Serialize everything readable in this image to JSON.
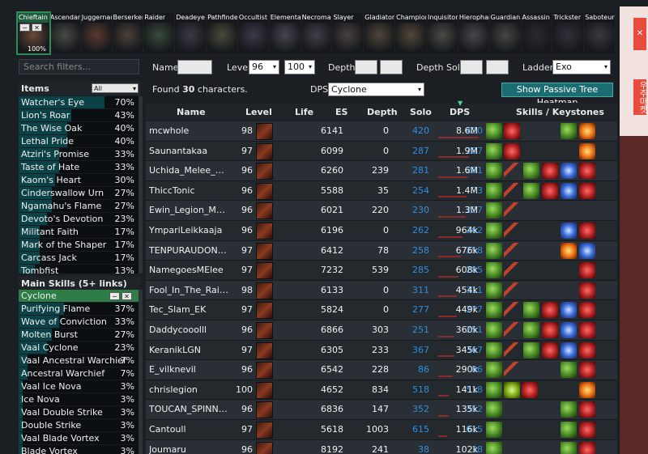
{
  "class_bar": {
    "active_percent": "100%",
    "classes": [
      {
        "name": "Chieftain",
        "active": true,
        "color": "#6a4a3a"
      },
      {
        "name": "Ascendant",
        "color": "#4a4a44"
      },
      {
        "name": "Juggernaut",
        "color": "#5a3a30"
      },
      {
        "name": "Berserker",
        "color": "#4a4038"
      },
      {
        "name": "Raider",
        "color": "#3a4a3a"
      },
      {
        "name": "Deadeye",
        "color": "#3a3a44"
      },
      {
        "name": "Pathfinder",
        "color": "#4a4a3a"
      },
      {
        "name": "Occultist",
        "color": "#3a3a4a"
      },
      {
        "name": "Elementalist",
        "color": "#4a4450"
      },
      {
        "name": "Necromancer",
        "color": "#404048"
      },
      {
        "name": "Slayer",
        "color": "#4a4040"
      },
      {
        "name": "Gladiator",
        "color": "#50463a"
      },
      {
        "name": "Champion",
        "color": "#54483a"
      },
      {
        "name": "Inquisitor",
        "color": "#4c4a44"
      },
      {
        "name": "Hierophant",
        "color": "#48484a"
      },
      {
        "name": "Guardian",
        "color": "#4a4640"
      },
      {
        "name": "Assassin",
        "color": "#2a2a2e"
      },
      {
        "name": "Trickster",
        "color": "#32303a"
      },
      {
        "name": "Saboteur",
        "color": "#3a3a40"
      }
    ]
  },
  "ad": {
    "text": "우주마켓"
  },
  "left": {
    "search_placeholder": "Search filters...",
    "items_title": "Items",
    "items_filter": "All",
    "items": [
      {
        "label": "Watcher's Eye",
        "value": "70%",
        "pct": 70
      },
      {
        "label": "Lion's Roar",
        "value": "43%",
        "pct": 43
      },
      {
        "label": "The Wise Oak",
        "value": "40%",
        "pct": 40
      },
      {
        "label": "Lethal Pride",
        "value": "40%",
        "pct": 40
      },
      {
        "label": "Atziri's Promise",
        "value": "33%",
        "pct": 33
      },
      {
        "label": "Taste of Hate",
        "value": "33%",
        "pct": 33
      },
      {
        "label": "Kaom's Heart",
        "value": "30%",
        "pct": 30
      },
      {
        "label": "Cinderswallow Urn",
        "value": "27%",
        "pct": 27
      },
      {
        "label": "Ngamahu's Flame",
        "value": "27%",
        "pct": 27
      },
      {
        "label": "Devoto's Devotion",
        "value": "23%",
        "pct": 23
      },
      {
        "label": "Militant Faith",
        "value": "17%",
        "pct": 17
      },
      {
        "label": "Mark of the Shaper",
        "value": "17%",
        "pct": 17
      },
      {
        "label": "Carcass Jack",
        "value": "17%",
        "pct": 17
      },
      {
        "label": "Tombfist",
        "value": "13%",
        "pct": 13
      }
    ],
    "skills_title": "Main Skills (5+ links)",
    "skills": [
      {
        "label": "Cyclone",
        "value": "",
        "pct": 100,
        "selected": true
      },
      {
        "label": "Purifying Flame",
        "value": "37%",
        "pct": 37
      },
      {
        "label": "Wave of Conviction",
        "value": "33%",
        "pct": 33
      },
      {
        "label": "Molten Burst",
        "value": "27%",
        "pct": 27
      },
      {
        "label": "Vaal Cyclone",
        "value": "23%",
        "pct": 23
      },
      {
        "label": "Vaal Ancestral Warchief",
        "value": "7%",
        "pct": 7
      },
      {
        "label": "Ancestral Warchief",
        "value": "7%",
        "pct": 7
      },
      {
        "label": "Vaal Ice Nova",
        "value": "3%",
        "pct": 3
      },
      {
        "label": "Ice Nova",
        "value": "3%",
        "pct": 3
      },
      {
        "label": "Vaal Double Strike",
        "value": "3%",
        "pct": 3
      },
      {
        "label": "Double Strike",
        "value": "3%",
        "pct": 3
      },
      {
        "label": "Vaal Blade Vortex",
        "value": "3%",
        "pct": 3
      },
      {
        "label": "Blade Vortex",
        "value": "3%",
        "pct": 3
      }
    ]
  },
  "filters": {
    "name_label": "Name",
    "level_label": "Level",
    "level_min": "96",
    "level_max": "100",
    "depth_label": "Depth",
    "depth_solo_label": "Depth Solo",
    "ladder_label": "Ladder",
    "ladder_value": "Exo"
  },
  "summary": {
    "found_prefix": "Found ",
    "found_count": "30",
    "found_suffix": " characters.",
    "dps_label": "DPS",
    "dps_value": "Cyclone",
    "heatmap_button": "Show Passive Tree Heatmap"
  },
  "table": {
    "headers": {
      "name": "Name",
      "level": "Level",
      "life": "Life",
      "es": "ES",
      "depth": "Depth",
      "solo": "Solo",
      "dps": "DPS",
      "skills": "Skills / Keystones"
    },
    "rows": [
      {
        "name": "mcwhole",
        "level": "98",
        "life": "6141",
        "es": "0",
        "depth": "420",
        "solo": "420",
        "dps": "8.6M",
        "dps_frac": 1.0,
        "skills": [
          "cyclone",
          "red"
        ],
        "keys": [
          "cyclone",
          "fire"
        ]
      },
      {
        "name": "Saunantakaa",
        "level": "97",
        "life": "6099",
        "es": "0",
        "depth": "287",
        "solo": "287",
        "dps": "1.9M",
        "dps_frac": 0.75,
        "skills": [
          "cyclone",
          "red"
        ],
        "keys": [
          "fire"
        ]
      },
      {
        "name": "Uchida_Melee_Ret...",
        "level": "96",
        "life": "6260",
        "es": "239",
        "depth": "281",
        "solo": "281",
        "dps": "1.6M",
        "dps_frac": 0.72,
        "skills": [
          "cyclone",
          "axe"
        ],
        "keys": [
          "cyclone",
          "red",
          "blue",
          "red"
        ]
      },
      {
        "name": "ThiccTonic",
        "level": "96",
        "life": "5588",
        "es": "35",
        "depth": "254",
        "solo": "73",
        "dps": "1.4M",
        "dps_frac": 0.7,
        "skills": [
          "cyclone",
          "axe"
        ],
        "keys": [
          "cyclone",
          "red",
          "blue",
          "red"
        ]
      },
      {
        "name": "Ewin_Legion_Mar...",
        "level": "96",
        "life": "6021",
        "es": "220",
        "depth": "230",
        "solo": "227",
        "dps": "1.3M",
        "dps_frac": 0.68,
        "skills": [
          "cyclone",
          "axe"
        ],
        "keys": []
      },
      {
        "name": "YmpariLeikkaaja",
        "level": "96",
        "life": "6196",
        "es": "0",
        "depth": "262",
        "solo": "262",
        "dps": "964k",
        "dps_frac": 0.6,
        "skills": [
          "cyclone",
          "axe"
        ],
        "keys": [
          "blue",
          "red"
        ]
      },
      {
        "name": "TENPURAUDON_...",
        "level": "97",
        "life": "6412",
        "es": "78",
        "depth": "258",
        "solo": "258",
        "dps": "676k",
        "dps_frac": 0.55,
        "skills": [
          "cyclone",
          "axe"
        ],
        "keys": [
          "fire",
          "blue"
        ]
      },
      {
        "name": "NamegoesMElee",
        "level": "97",
        "life": "7232",
        "es": "539",
        "depth": "285",
        "solo": "285",
        "dps": "608k",
        "dps_frac": 0.5,
        "skills": [
          "cyclone",
          "axe"
        ],
        "keys": [
          "red"
        ]
      },
      {
        "name": "Fool_In_The_Rain_",
        "level": "98",
        "life": "6133",
        "es": "0",
        "depth": "311",
        "solo": "311",
        "dps": "454k",
        "dps_frac": 0.45,
        "skills": [
          "cyclone",
          "axe"
        ],
        "keys": [
          "red"
        ]
      },
      {
        "name": "Tec_Slam_EK",
        "level": "97",
        "life": "5824",
        "es": "0",
        "depth": "277",
        "solo": "277",
        "dps": "449k",
        "dps_frac": 0.45,
        "skills": [
          "cyclone",
          "axe"
        ],
        "keys": [
          "cyclone",
          "red",
          "blue",
          "red"
        ]
      },
      {
        "name": "Daddycooolll",
        "level": "96",
        "life": "6866",
        "es": "303",
        "depth": "251",
        "solo": "251",
        "dps": "360k",
        "dps_frac": 0.4,
        "skills": [
          "cyclone",
          "axe"
        ],
        "keys": [
          "cyclone",
          "red",
          "blue",
          "red"
        ]
      },
      {
        "name": "KeranikLGN",
        "level": "97",
        "life": "6305",
        "es": "233",
        "depth": "367",
        "solo": "367",
        "dps": "345k",
        "dps_frac": 0.4,
        "skills": [
          "cyclone",
          "axe"
        ],
        "keys": [
          "cyclone",
          "red",
          "blue",
          "red"
        ]
      },
      {
        "name": "E_vilknevil",
        "level": "96",
        "life": "6542",
        "es": "228",
        "depth": "86",
        "solo": "86",
        "dps": "290k",
        "dps_frac": 0.35,
        "skills": [
          "cyclone",
          "axe"
        ],
        "keys": [
          "cyclone",
          "red"
        ]
      },
      {
        "name": "chrislegion",
        "level": "100",
        "life": "4652",
        "es": "834",
        "depth": "518",
        "solo": "518",
        "dps": "141k",
        "dps_frac": 0.25,
        "skills": [
          "cyclone",
          "green2",
          "red"
        ],
        "keys": [
          "fire"
        ]
      },
      {
        "name": "TOUCAN_SPINNIN...",
        "level": "96",
        "life": "6836",
        "es": "147",
        "depth": "352",
        "solo": "352",
        "dps": "135k",
        "dps_frac": 0.25,
        "skills": [
          "cyclone"
        ],
        "keys": [
          "cyclone",
          "red"
        ]
      },
      {
        "name": "Cantoull",
        "level": "97",
        "life": "5618",
        "es": "1003",
        "depth": "615",
        "solo": "615",
        "dps": "116k",
        "dps_frac": 0.22,
        "skills": [
          "cyclone"
        ],
        "keys": [
          "cyclone",
          "red"
        ]
      },
      {
        "name": "Joumaru",
        "level": "96",
        "life": "8192",
        "es": "241",
        "depth": "38",
        "solo": "38",
        "dps": "102k",
        "dps_frac": 0.2,
        "skills": [
          "cyclone"
        ],
        "keys": [
          "cyclone",
          "red"
        ]
      }
    ]
  }
}
